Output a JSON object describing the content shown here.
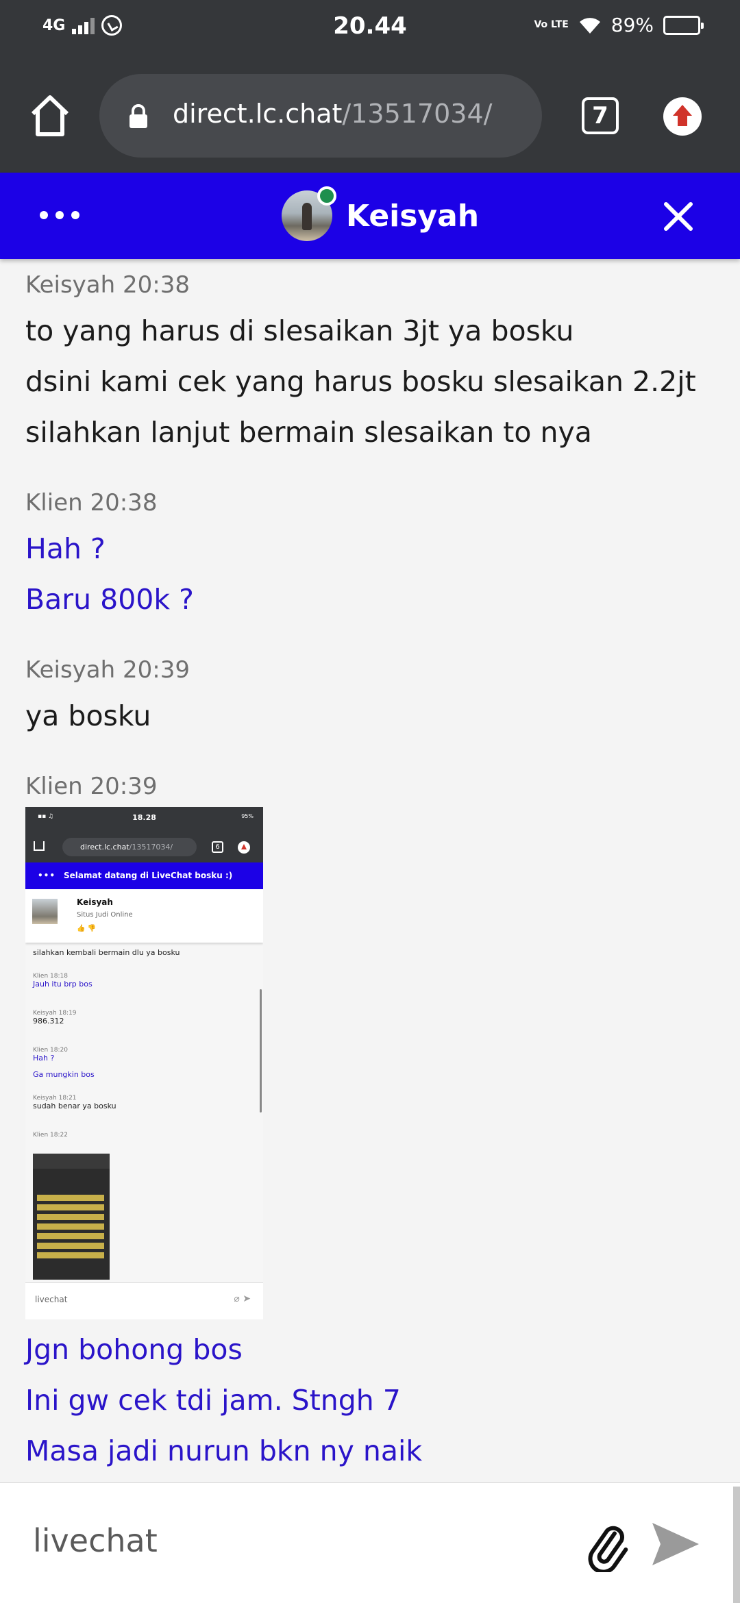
{
  "status_bar": {
    "network": "4G",
    "time": "20.44",
    "volte": "Vo LTE",
    "battery": "89%",
    "battery_level": 0.89
  },
  "browser": {
    "url_domain": "direct.lc.chat",
    "url_path": "/13517034/",
    "tab_count": "7"
  },
  "chat_header": {
    "agent_name": "Keisyah",
    "online": true
  },
  "messages": [
    {
      "sender": "Keisyah",
      "time": "20:38",
      "meta": "Keisyah 20:38",
      "role": "agent",
      "lines": [
        "to yang harus di slesaikan 3jt ya bosku",
        "dsini kami cek yang harus bosku slesaikan 2.2jt",
        "silahkan lanjut bermain slesaikan to nya"
      ]
    },
    {
      "sender": "Klien",
      "time": "20:38",
      "meta": "Klien 20:38",
      "role": "client",
      "lines": [
        "Hah ?",
        "Baru 800k ?"
      ]
    },
    {
      "sender": "Keisyah",
      "time": "20:39",
      "meta": "Keisyah 20:39",
      "role": "agent",
      "lines": [
        "ya bosku"
      ]
    },
    {
      "sender": "Klien",
      "time": "20:39",
      "meta": "Klien 20:39",
      "role": "client",
      "lines": [
        "Jgn bohong bos",
        "Ini gw cek tdi jam. Stngh 7",
        "Masa jadi nurun bkn ny naik"
      ]
    }
  ],
  "attachment_screenshot": {
    "time": "18.28",
    "battery": "95%",
    "url_domain": "direct.lc.chat",
    "url_path": "/13517034/",
    "tab_count": "6",
    "header": "Selamat datang di LiveChat bosku :)",
    "agent_name": "Keisyah",
    "agent_subtitle": "Situs Judi Online",
    "rows": [
      {
        "meta": "",
        "text": "silahkan kembali bermain dlu ya bosku",
        "role": "agent"
      },
      {
        "meta": "Klien 18:18",
        "text": "Jauh itu brp bos",
        "role": "client"
      },
      {
        "meta": "Keisyah 18:19",
        "text": "986.312",
        "role": "agent"
      },
      {
        "meta": "Klien 18:20",
        "text": "Hah ?",
        "role": "client"
      },
      {
        "meta": "",
        "text": "Ga mungkin bos",
        "role": "client"
      },
      {
        "meta": "Keisyah 18:21",
        "text": "sudah benar ya bosku",
        "role": "agent"
      },
      {
        "meta": "Klien 18:22",
        "text": "",
        "role": "client"
      }
    ],
    "input_placeholder": "livechat"
  },
  "input": {
    "placeholder": "livechat"
  },
  "colors": {
    "header_bg": "#1c01e6",
    "client_text": "#2a14c9",
    "browser_bg": "#35373a",
    "online": "#1e8f4e"
  }
}
